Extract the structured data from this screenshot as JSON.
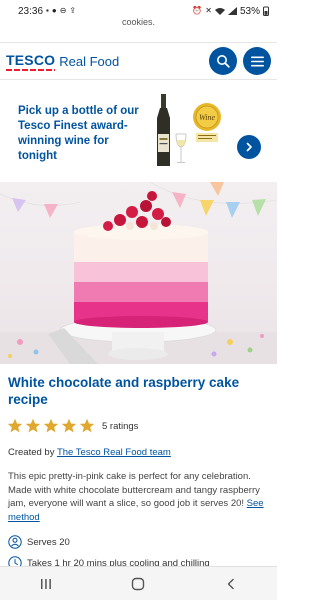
{
  "status_bar": {
    "time": "23:36",
    "battery": "53%",
    "left_icons": [
      "notification-icon",
      "messenger-icon",
      "minus-circle-icon",
      "upload-icon"
    ],
    "right_icons": [
      "alarm-icon",
      "mute-icon",
      "wifi-icon",
      "signal-icon",
      "battery-icon"
    ]
  },
  "cookie_banner": {
    "text": "cookies."
  },
  "header": {
    "logo_brand": "TESCO",
    "logo_suffix": "Real Food",
    "search_icon": "search-icon",
    "menu_icon": "menu-icon"
  },
  "promo": {
    "text": "Pick up a bottle of our Tesco Finest award-winning wine for tonight",
    "award_label": "Wine",
    "arrow_icon": "chevron-right-icon"
  },
  "recipe": {
    "title": "White chocolate and raspberry cake recipe",
    "rating_value": 5,
    "rating_count": "5 ratings",
    "created_prefix": "Created by",
    "created_by": "The Tesco Real Food team",
    "description": "This epic pretty-in-pink cake is perfect for any celebration. Made with white chocolate buttercream and tangy raspberry jam, everyone will want a slice, so good job it serves 20!",
    "see_method": "See method",
    "serves": "Serves 20",
    "time": "Takes 1 hr 20 mins plus cooling and chilling"
  },
  "colors": {
    "brand_blue": "#00539f",
    "brand_red": "#ee1c2e",
    "star_gold": "#e0a82e"
  },
  "nav_bar": {
    "icons": [
      "recents-icon",
      "home-icon",
      "back-icon"
    ]
  }
}
